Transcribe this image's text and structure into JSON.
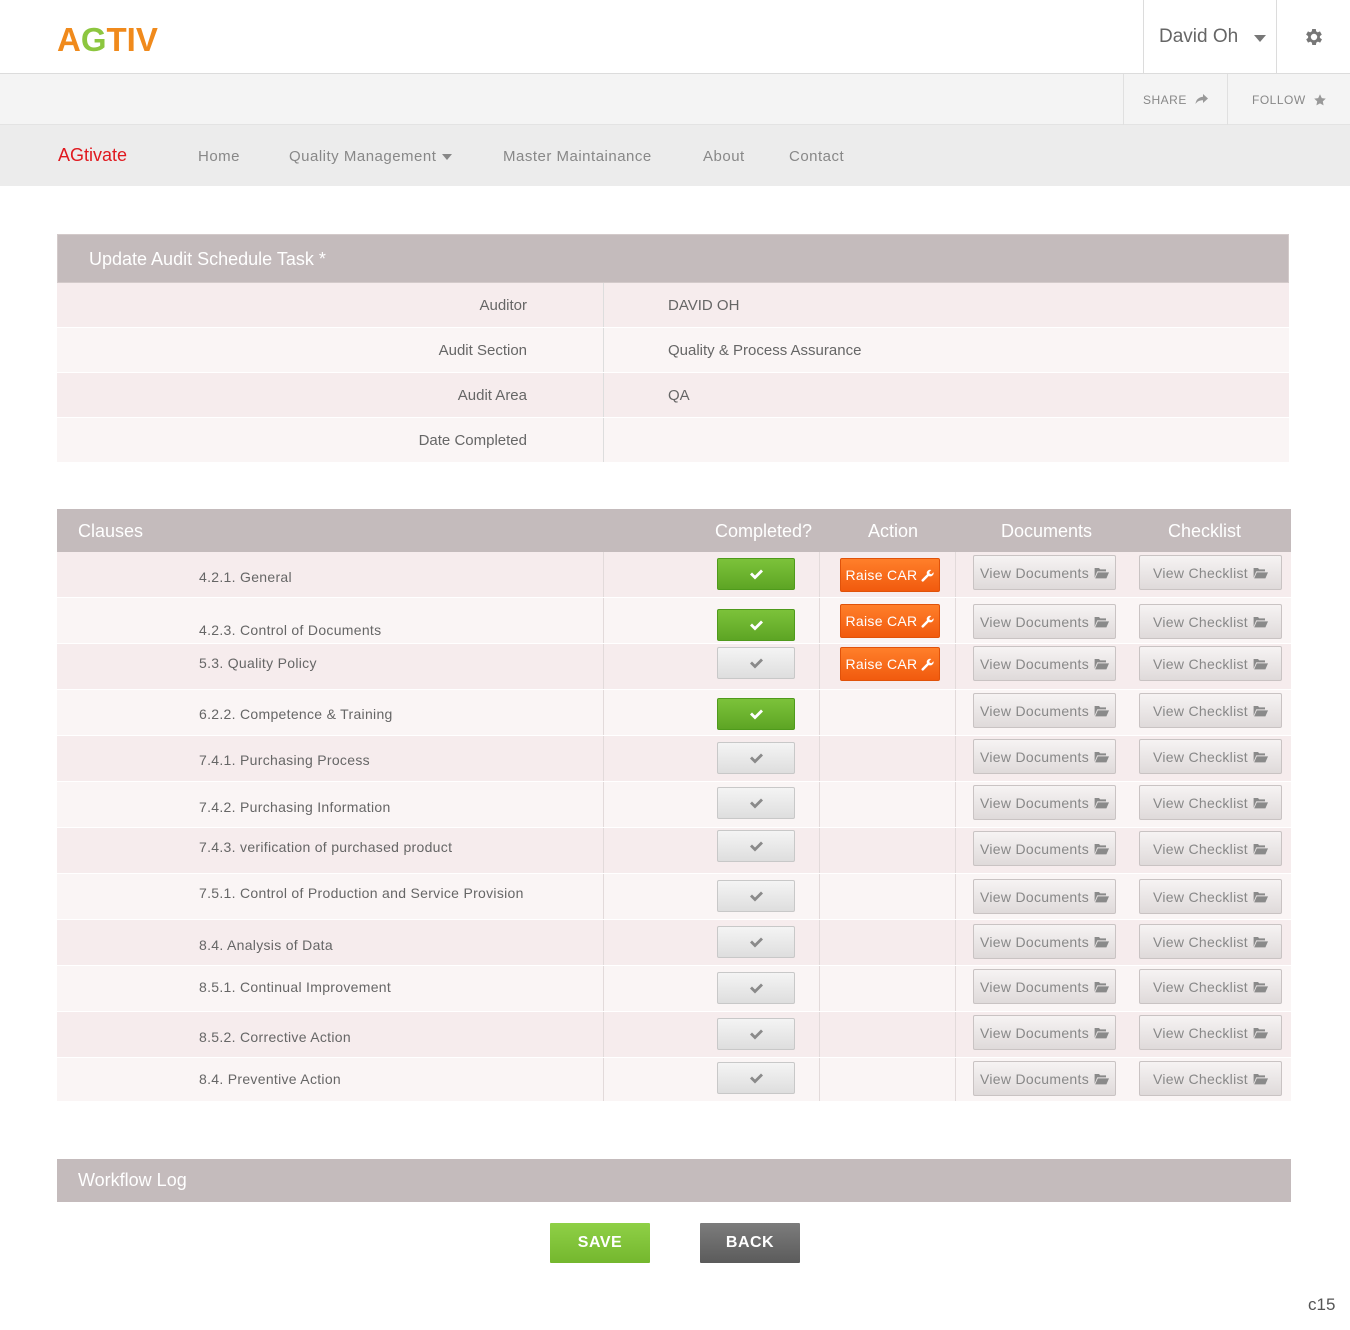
{
  "header": {
    "logo": {
      "part1": "A",
      "part2": "G",
      "part3": "TIV"
    },
    "user_name": "David Oh",
    "icons": {
      "user_menu": "chevron-down-icon",
      "settings": "gear-icon"
    }
  },
  "sharebar": {
    "share_label": "SHARE",
    "follow_label": "FOLLOW",
    "icons": {
      "share": "share-arrow-icon",
      "follow": "star-icon"
    }
  },
  "nav": {
    "brand": "AGtivate",
    "items": [
      "Home",
      "Quality Management",
      "Master Maintainance",
      "About",
      "Contact"
    ]
  },
  "task": {
    "title": "Update Audit Schedule Task *",
    "fields": [
      {
        "label": "Auditor",
        "value": "DAVID OH"
      },
      {
        "label": "Audit Section",
        "value": "Quality & Process Assurance"
      },
      {
        "label": "Audit Area",
        "value": "QA"
      },
      {
        "label": "Date Completed",
        "value": ""
      }
    ]
  },
  "clauses": {
    "headers": {
      "clauses": "Clauses",
      "completed": "Completed?",
      "action": "Action",
      "documents": "Documents",
      "checklist": "Checklist"
    },
    "raise_car_label": "Raise CAR",
    "view_documents_label": "View Documents",
    "view_checklist_label": "View Checklist",
    "rows": [
      {
        "name": "4.2.1. General",
        "completed": true,
        "raise_car": true
      },
      {
        "name": "4.2.3. Control of Documents",
        "completed": true,
        "raise_car": true
      },
      {
        "name": "5.3. Quality Policy",
        "completed": false,
        "raise_car": true
      },
      {
        "name": "6.2.2. Competence & Training",
        "completed": true,
        "raise_car": false
      },
      {
        "name": "7.4.1. Purchasing Process",
        "completed": false,
        "raise_car": false
      },
      {
        "name": "7.4.2. Purchasing Information",
        "completed": false,
        "raise_car": false
      },
      {
        "name": "7.4.3. verification of purchased product",
        "completed": false,
        "raise_car": false
      },
      {
        "name": "7.5.1. Control of Production and  Service Provision",
        "completed": false,
        "raise_car": false
      },
      {
        "name": "8.4. Analysis of Data",
        "completed": false,
        "raise_car": false
      },
      {
        "name": "8.5.1. Continual Improvement",
        "completed": false,
        "raise_car": false
      },
      {
        "name": "8.5.2. Corrective Action",
        "completed": false,
        "raise_car": false
      },
      {
        "name": "8.4. Preventive Action",
        "completed": false,
        "raise_car": false
      }
    ]
  },
  "workflow": {
    "title": "Workflow Log"
  },
  "actions": {
    "save_label": "SAVE",
    "back_label": "BACK"
  },
  "corner_code": "c15",
  "colors": {
    "brand_red": "#e0191f",
    "logo_orange": "#f08a1c",
    "logo_green": "#8cc63f",
    "check_green": "#6bb52f",
    "car_orange": "#f26a1b",
    "panel_head": "#c4bbbc"
  }
}
